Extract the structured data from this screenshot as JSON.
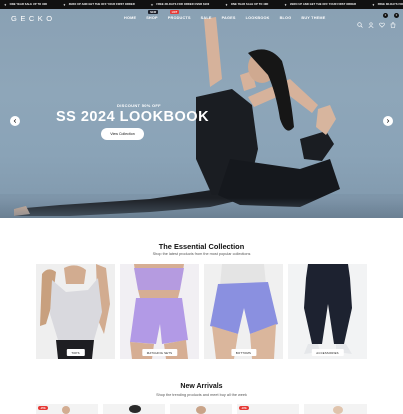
{
  "ticker": {
    "items": [
      "ONE YEAR SALE UP TO 40D",
      "ZERO UP AND GET THE OFF YOUR FIRST ORDER",
      "FREE 3D-DAYS FOR ORDER OVER $100",
      "ONE YEAR SALE UP TO 40D",
      "ZERO UP AND GET THE OFF YOUR FIRST ORDER",
      "FREE 3D-DAYS FOR ORDER OVER $100"
    ]
  },
  "header": {
    "logo": "GECKO",
    "nav": [
      {
        "label": "HOME",
        "badge": null
      },
      {
        "label": "SHOP",
        "badge": "NEW"
      },
      {
        "label": "PRODUCTS",
        "badge": "HOT"
      },
      {
        "label": "SALE",
        "badge": null
      },
      {
        "label": "PAGES",
        "badge": null
      },
      {
        "label": "LOOKBOOK",
        "badge": null
      },
      {
        "label": "BLOG",
        "badge": null
      },
      {
        "label": "BUY THEME",
        "badge": null
      }
    ],
    "icons": [
      "search-icon",
      "user-icon",
      "heart-icon",
      "cart-icon"
    ],
    "wishlist_count": "0",
    "cart_count": "0"
  },
  "hero": {
    "eyebrow": "DISCOUNT 50% OFF",
    "title": "SS 2024 LOOKBOOK",
    "button": "View Collection",
    "slides": 2,
    "active_slide": 1
  },
  "collection": {
    "title": "The Essential Collection",
    "subtitle": "Shop the latest products from the most popular collections",
    "cards": [
      {
        "label": "TOPS"
      },
      {
        "label": "MATCHING SETS"
      },
      {
        "label": "BOTTOMS"
      },
      {
        "label": "ACCESSORIES"
      }
    ]
  },
  "arrivals": {
    "title": "New Arrivals",
    "subtitle": "Shop the trending products and meet buy all the week",
    "badges": [
      "-15%",
      "-10%"
    ]
  },
  "colors": {
    "hero_bg": "#8ea6b9",
    "badge_hot": "#e53935",
    "badge_new": "#1b1f2a",
    "dark": "#111111"
  }
}
